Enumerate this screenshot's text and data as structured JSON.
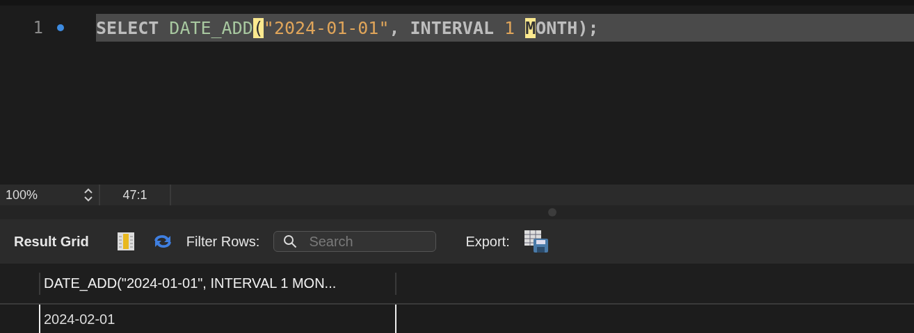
{
  "editor": {
    "lines": [
      {
        "number": "1",
        "marker": true,
        "current": true,
        "tokens": [
          {
            "kind": "keyword",
            "text": "SELECT ",
            "highlight": false
          },
          {
            "kind": "function",
            "text": "DATE_ADD",
            "highlight": false
          },
          {
            "kind": "function",
            "text": "(",
            "highlight": true
          },
          {
            "kind": "string",
            "text": "\"2024-01-01\"",
            "highlight": false
          },
          {
            "kind": "keyword",
            "text": ", INTERVAL ",
            "highlight": false
          },
          {
            "kind": "number",
            "text": "1 ",
            "highlight": false
          },
          {
            "kind": "keyword",
            "text": "M",
            "highlight": true
          },
          {
            "kind": "keyword",
            "text": "ONTH);",
            "highlight": false
          }
        ]
      }
    ]
  },
  "status_bar": {
    "zoom": "100%",
    "position": "47:1"
  },
  "toolbar": {
    "title": "Result Grid",
    "filter_label": "Filter Rows:",
    "search": {
      "placeholder": "Search"
    },
    "export_label": "Export:"
  },
  "result_grid": {
    "columns": [
      "DATE_ADD(\"2024-01-01\", INTERVAL 1 MON..."
    ],
    "rows": [
      [
        "2024-02-01"
      ]
    ]
  }
}
